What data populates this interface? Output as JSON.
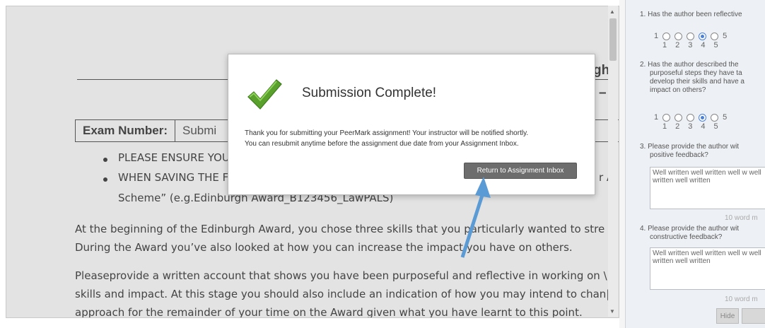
{
  "document": {
    "heading_fragment": "gh",
    "heading_dash": "–",
    "exam_label": "Exam Number:",
    "exam_value": "Submi",
    "bullets": [
      "PLEASE ENSURE YOU",
      "WHEN SAVING THE F"
    ],
    "bullet_right_frag": "r A\\",
    "bullet2_cont": "Scheme” (e.g.Edinburgh Award_B123456_LawPALS)",
    "paragraph1": [
      "At the beginning of the Edinburgh Award, you chose three skills that you particularly wanted to stre",
      "During the Award you’ve also looked at how you can increase the impact you have on others."
    ],
    "paragraph2": [
      "Pleaseprovide a written account that shows you have been purposeful and reflective in working on \\",
      "skills and impact. At this stage you should also include an indication of how you may intend to chan|",
      "approach for the remainder of your time on the Award given what you have learnt to this point."
    ]
  },
  "modal": {
    "title": "Submission Complete!",
    "message_line1": "Thank you for submitting your PeerMark assignment! Your instructor will be notified shortly.",
    "message_line2": "You can resubmit anytime before the assignment due date from your Assignment Inbox.",
    "button_label": "Return to Assignment Inbox",
    "icon": "checkmark-icon",
    "accent": "#5aa02c"
  },
  "side_panel": {
    "q1": "1. Has the author been reflective",
    "q2": [
      "2. Has the author described the",
      "purposeful steps they have ta",
      "develop their skills and have a",
      "impact on others?"
    ],
    "q3": [
      "3. Please provide the author wit",
      "positive feedback?"
    ],
    "q4": [
      "4. Please provide the author wit",
      "constructive feedback?"
    ],
    "scale_first": "1",
    "scale_last": "5",
    "scale_numbers": [
      "1",
      "2",
      "3",
      "4",
      "5"
    ],
    "q1_selected": 4,
    "q2_selected": 4,
    "answer3": "Well written well written well w well written well written",
    "answer4": "Well written well written well w well written well written",
    "count3": "10 word m",
    "count4": "10 word m",
    "hide_label": "Hide",
    "radio_accent": "#4a7fd6"
  },
  "annotation": {
    "arrow_color": "#5b9bd5"
  }
}
